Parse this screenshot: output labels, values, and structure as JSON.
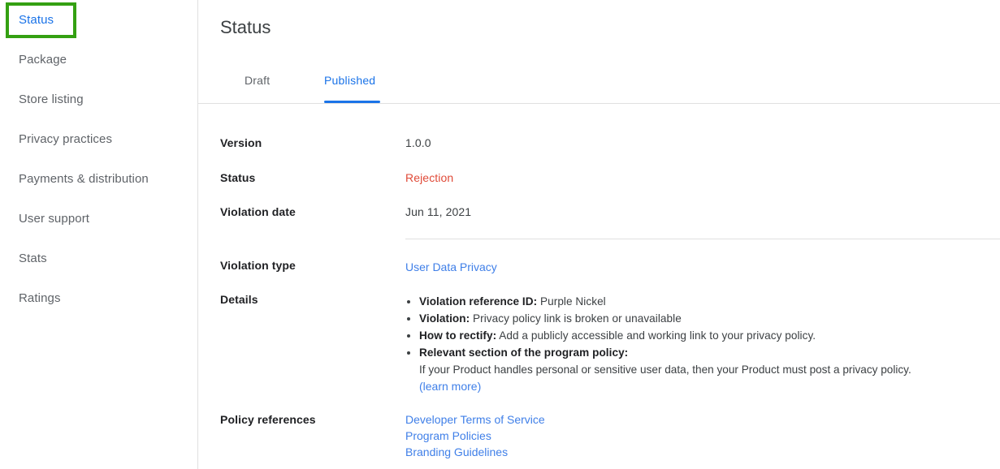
{
  "sidebar": {
    "items": [
      {
        "label": "Status",
        "active": true,
        "highlighted": true
      },
      {
        "label": "Package",
        "active": false,
        "highlighted": false
      },
      {
        "label": "Store listing",
        "active": false,
        "highlighted": false
      },
      {
        "label": "Privacy practices",
        "active": false,
        "highlighted": false
      },
      {
        "label": "Payments & distribution",
        "active": false,
        "highlighted": false
      },
      {
        "label": "User support",
        "active": false,
        "highlighted": false
      },
      {
        "label": "Stats",
        "active": false,
        "highlighted": false
      },
      {
        "label": "Ratings",
        "active": false,
        "highlighted": false
      }
    ]
  },
  "main": {
    "title": "Status",
    "tabs": [
      {
        "label": "Draft",
        "active": false
      },
      {
        "label": "Published",
        "active": true
      }
    ],
    "rows": {
      "version_label": "Version",
      "version_value": "1.0.0",
      "status_label": "Status",
      "status_value": "Rejection",
      "violation_date_label": "Violation date",
      "violation_date_value": "Jun 11, 2021",
      "violation_type_label": "Violation type",
      "violation_type_value": "User Data Privacy",
      "details_label": "Details",
      "policy_references_label": "Policy references"
    },
    "details": {
      "bullets": [
        {
          "term": "Violation reference ID:",
          "text": " Purple Nickel"
        },
        {
          "term": "Violation:",
          "text": " Privacy policy link is broken or unavailable"
        },
        {
          "term": "How to rectify:",
          "text": " Add a publicly accessible and working link to your privacy policy."
        },
        {
          "term": "Relevant section of the program policy:",
          "text": ""
        }
      ],
      "policy_text": "If your Product handles personal or sensitive user data, then your Product must post a privacy policy.",
      "learn_more": "(learn more)"
    },
    "policy_references": [
      "Developer Terms of Service",
      "Program Policies",
      "Branding Guidelines"
    ]
  },
  "colors": {
    "link_blue": "#3f7fe8",
    "tab_active_blue": "#1a73e8",
    "status_red": "#e04a38",
    "highlight_green": "#34a012",
    "text_dark": "#202124",
    "text_gray": "#5f6368",
    "border_gray": "#e0e0e0"
  }
}
